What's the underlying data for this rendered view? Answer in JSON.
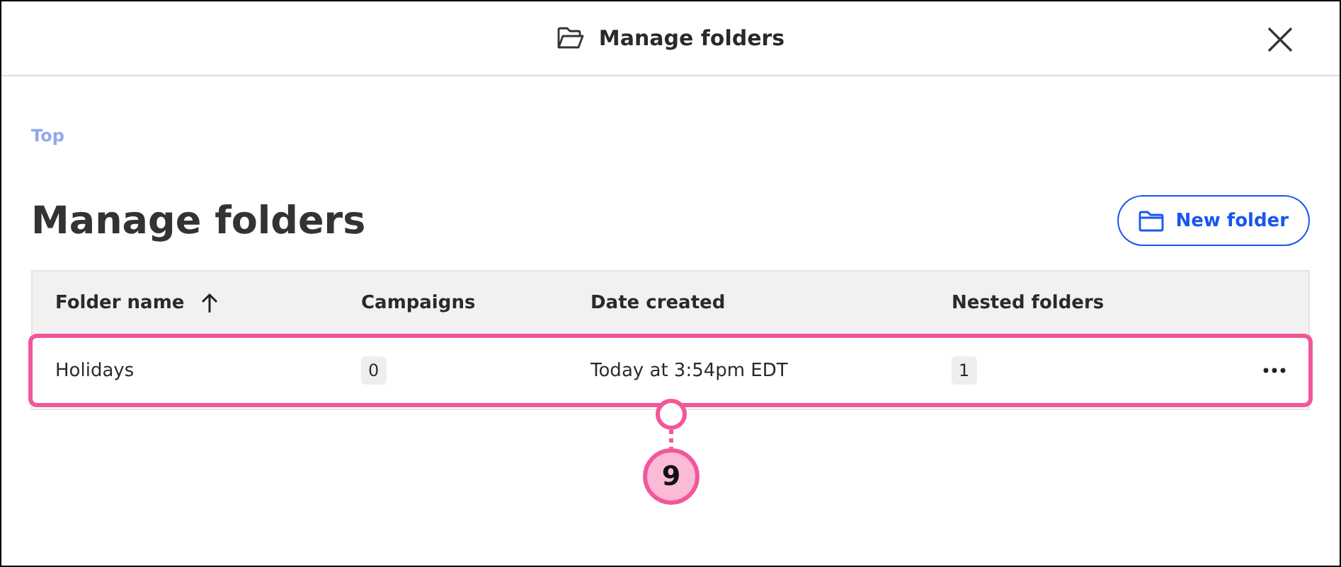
{
  "dialog": {
    "title": "Manage folders"
  },
  "breadcrumb": "Top",
  "heading": "Manage folders",
  "new_folder_button": "New folder",
  "table": {
    "columns": [
      {
        "label": "Folder name",
        "sorted": true
      },
      {
        "label": "Campaigns",
        "sorted": false
      },
      {
        "label": "Date created",
        "sorted": false
      },
      {
        "label": "Nested folders",
        "sorted": false
      }
    ],
    "rows": [
      {
        "name": "Holidays",
        "campaigns": "0",
        "date": "Today at 3:54pm EDT",
        "nested": "1",
        "highlighted": true
      }
    ]
  },
  "callout": {
    "number": "9"
  }
}
